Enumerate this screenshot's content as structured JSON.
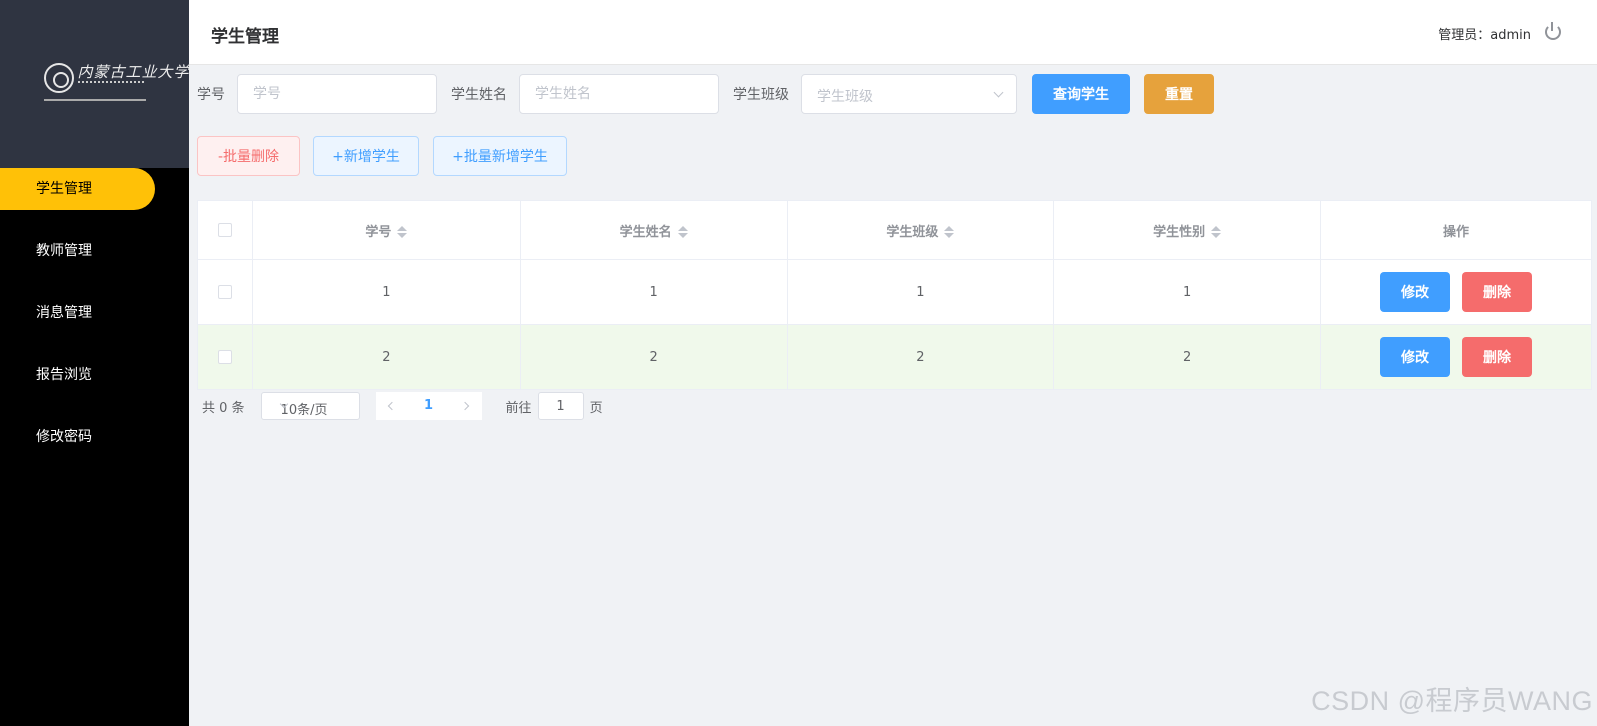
{
  "logo": {
    "text": "内蒙古工业大学"
  },
  "sidebar": {
    "items": [
      {
        "label": "学生管理",
        "active": true
      },
      {
        "label": "教师管理"
      },
      {
        "label": "消息管理"
      },
      {
        "label": "报告浏览"
      },
      {
        "label": "修改密码"
      }
    ]
  },
  "header": {
    "title": "学生管理",
    "admin": "管理员：admin",
    "logout_icon": "power-icon"
  },
  "search": {
    "id_label": "学号",
    "id_placeholder": "学号",
    "name_label": "学生姓名",
    "name_placeholder": "学生姓名",
    "class_label": "学生班级",
    "class_placeholder": "学生班级",
    "query_button": "查询学生",
    "reset_button": "重置"
  },
  "actions": {
    "batch_delete": "-批量删除",
    "add": "+新增学生",
    "batch_add": "+批量新增学生"
  },
  "table": {
    "headers": [
      "学号",
      "学生姓名",
      "学生班级",
      "学生性别",
      "操作"
    ],
    "rows": [
      {
        "id": "1",
        "name": "1",
        "class": "1",
        "gender": "1"
      },
      {
        "id": "2",
        "name": "2",
        "class": "2",
        "gender": "2"
      }
    ],
    "edit_label": "修改",
    "delete_label": "删除"
  },
  "pagination": {
    "total": "共 0 条",
    "page_size": "10条/页",
    "current_page": "1",
    "goto_label": "前往",
    "goto_value": "1",
    "page_suffix": "页"
  },
  "watermark": "CSDN @程序员WANG",
  "colors": {
    "primary": "#409eff",
    "warning": "#e6a23c",
    "danger": "#f56c6c",
    "sidebar": "#000000",
    "active_menu": "#ffc107",
    "row_highlight": "#f0f9eb"
  }
}
